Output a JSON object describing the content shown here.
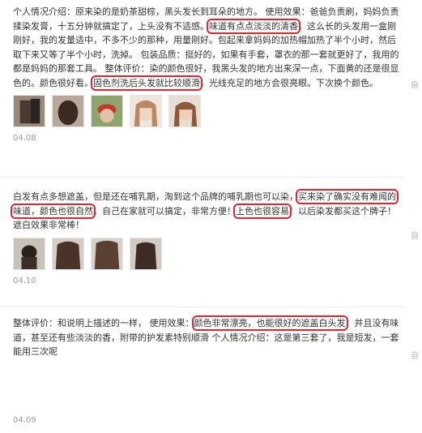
{
  "reviews": [
    {
      "segments": [
        "个人情况介绍：原来染的是奶茶甜棕，黑头发长到耳朵的地方。 使用效果：爸爸负责刷，妈妈负责揉染发膏，十五分钟就搞定了，上头没有不适感。",
        "味道有点点淡淡的清香",
        "，这么长的头发用一盒刚刚好，我的发量适中，不多不少的那种，用量刚好。包起来拿妈妈的加热帽加热了半个小时，然后取下来又等了半个小时，洗掉。 包装品质：挺好的，如果有手套，罩衣的那一套就更好了，我用的都是妈妈的那套工具。 整体评价：染的颜色很好，我黑头发的地方出来深一点，下面黄的还是很显色的。颜色很好看。",
        "固色剂洗后头发就比较顺滑",
        "，光线充足的地方会很亮眼。下次换个颜色。"
      ],
      "photos": 5,
      "date": "04.08"
    },
    {
      "segments": [
        "白发有点多想遮盖，但是还在哺乳期，淘到这个品牌的哺乳期也可以染，",
        "买来染了确实没有难闻的味道，颜色也很自然",
        "，自己在家就可以搞定，非常方便！",
        "上色也很容易",
        "！以后染发都买这个牌子！遮白效果非常棒！"
      ],
      "photos": 4,
      "date": "04.10"
    },
    {
      "segments": [
        "整体评价：和说明上描述的一样， 使用效果：",
        "颜色非常漂亮，也能很好的遮盖白头发",
        "，并且没有味道，甚至还有些淡淡的香，附带的护发素特别顺滑 个人情况介绍：这是第三套了，我是短发，一套能用三次呢",
        "",
        ""
      ],
      "photos": 0,
      "date": "04.09"
    }
  ],
  "colors": {
    "highlight": "#e0262f",
    "date": "#9c9c9c",
    "text": "#333333"
  },
  "edge_mark": "自"
}
